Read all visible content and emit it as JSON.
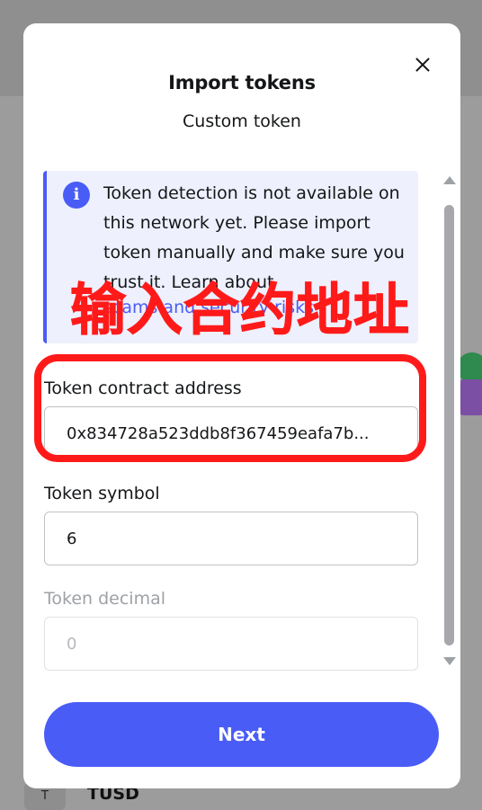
{
  "background": {
    "token_badge": "T",
    "token_name": "TUSD"
  },
  "modal": {
    "title": "Import tokens",
    "tab": "Custom token",
    "banner": {
      "text": "Token detection is not available on this network yet. Please import token manually and make sure you trust it. Learn about",
      "link": "scams and security risks"
    },
    "contract_address": {
      "label": "Token contract address",
      "value": "0x834728a523ddb8f367459eafa7b..."
    },
    "symbol": {
      "label": "Token symbol",
      "value": "6"
    },
    "decimal": {
      "label": "Token decimal",
      "placeholder": "0"
    },
    "next_label": "Next"
  },
  "annotation": {
    "text": "输入合约地址",
    "color": "#ff1a1a"
  },
  "colors": {
    "accent": "#4a5cf6",
    "banner_bg": "#eef0fd"
  }
}
